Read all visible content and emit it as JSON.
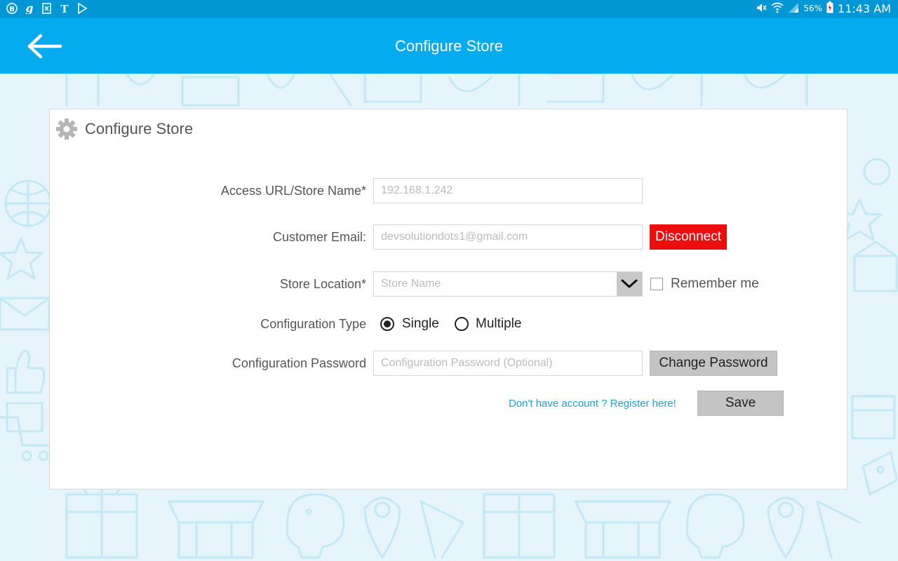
{
  "status_bar": {
    "battery": "56%",
    "time": "11:43 AM",
    "left_icons": [
      "b-badge-icon",
      "g-letter-icon",
      "doc-x-icon",
      "nyt-icon",
      "play-store-icon"
    ]
  },
  "app_bar": {
    "title": "Configure Store"
  },
  "card": {
    "title": "Configure Store",
    "access_url": {
      "label": "Access URL/Store Name*",
      "value": "192.168.1.242"
    },
    "customer_email": {
      "label": "Customer Email:",
      "value": "devsolutiondots1@gmail.com",
      "button": "Disconnect"
    },
    "store_location": {
      "label": "Store Location*",
      "placeholder": "Store Name",
      "remember_label": "Remember me",
      "remember_checked": false
    },
    "configuration_type": {
      "label": "Configuration Type",
      "options": [
        "Single",
        "Multiple"
      ],
      "selected": "Single"
    },
    "configuration_password": {
      "label": "Configuration Password",
      "placeholder": "Configuration Password (Optional)",
      "button": "Change Password"
    },
    "register_link": "Don't have account ? Register here!",
    "save_button": "Save"
  },
  "colors": {
    "status_bar": "#0197d5",
    "app_bar": "#05abef",
    "disconnect": "#ec0d0d",
    "link": "#1ba2d9",
    "pattern": "#bfe6f5"
  }
}
